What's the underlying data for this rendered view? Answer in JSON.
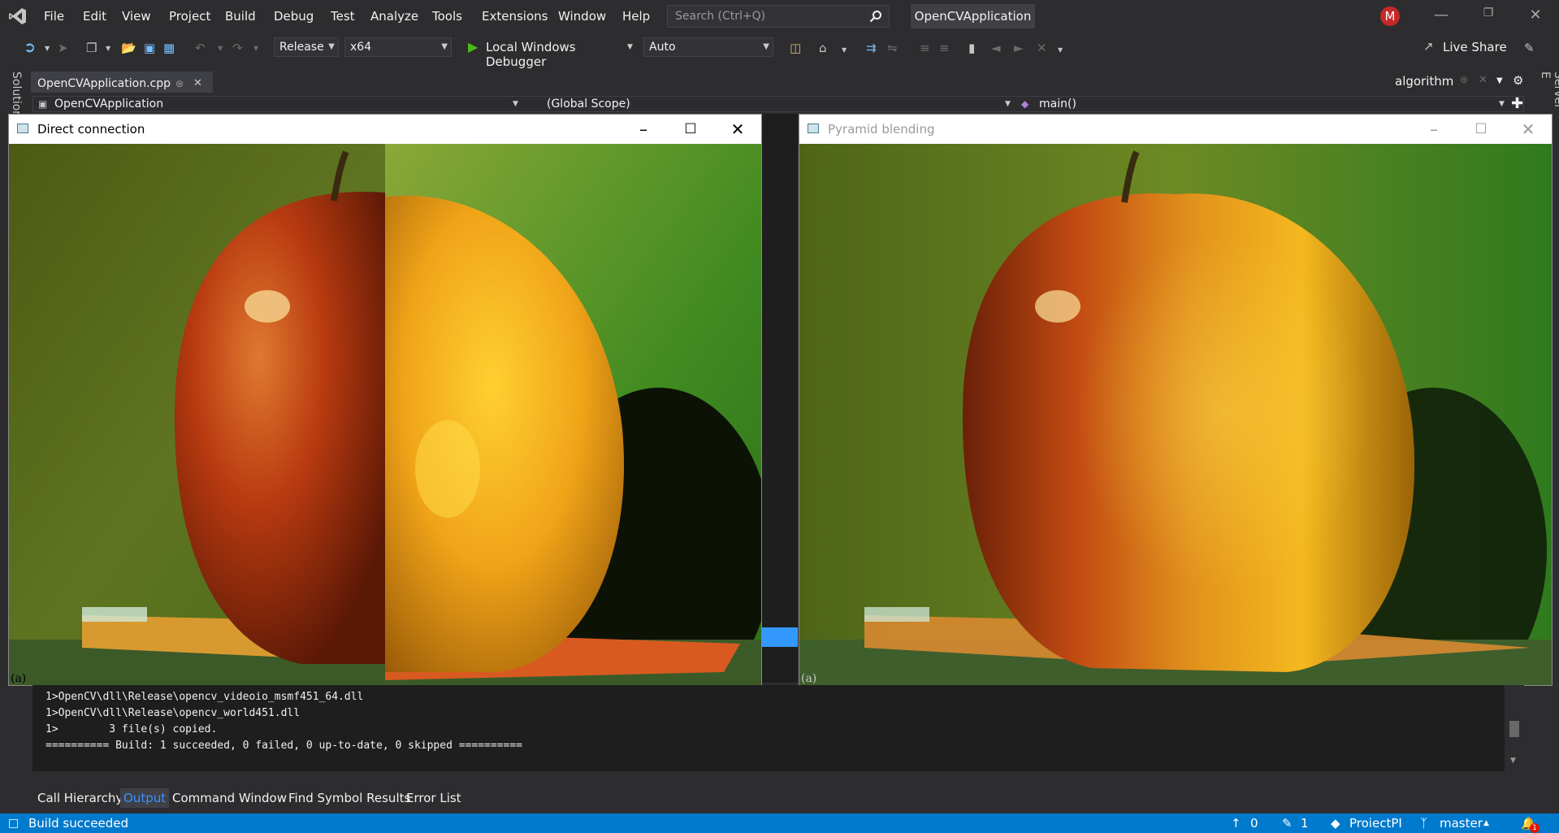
{
  "menu": [
    "File",
    "Edit",
    "View",
    "Project",
    "Build",
    "Debug",
    "Test",
    "Analyze",
    "Tools",
    "Extensions",
    "Window",
    "Help"
  ],
  "search_placeholder": "Search (Ctrl+Q)",
  "solution_name": "OpenCVApplication",
  "user_initial": "M",
  "toolbar": {
    "config": "Release",
    "platform": "x64",
    "debugger": "Local Windows Debugger",
    "mode": "Auto",
    "live_share": "Live Share"
  },
  "side_labels": {
    "left": "Solution",
    "right": "Server E"
  },
  "doc_tab": "OpenCVApplication.cpp",
  "search_tab": "algorithm",
  "nav": {
    "project": "OpenCVApplication",
    "scope": "(Global Scope)",
    "member": "main()"
  },
  "windows": [
    {
      "title": "Direct connection",
      "caption": "(a)"
    },
    {
      "title": "Pyramid blending",
      "caption": "(a)"
    }
  ],
  "output_lines": [
    "1>OpenCV\\dll\\Release\\opencv_videoio_msmf451_64.dll",
    "1>OpenCV\\dll\\Release\\opencv_world451.dll",
    "1>        3 file(s) copied.",
    "========== Build: 1 succeeded, 0 failed, 0 up-to-date, 0 skipped =========="
  ],
  "bottom_tabs": [
    "Call Hierarchy",
    "Output",
    "Command Window",
    "Find Symbol Results",
    "Error List"
  ],
  "status": {
    "message": "Build succeeded",
    "up_count": "0",
    "pencil_count": "1",
    "project": "ProiectPI",
    "branch": "master",
    "notifications": "1"
  },
  "colors": {
    "accent": "#007acc",
    "active_tab_text": "#3794ff"
  }
}
